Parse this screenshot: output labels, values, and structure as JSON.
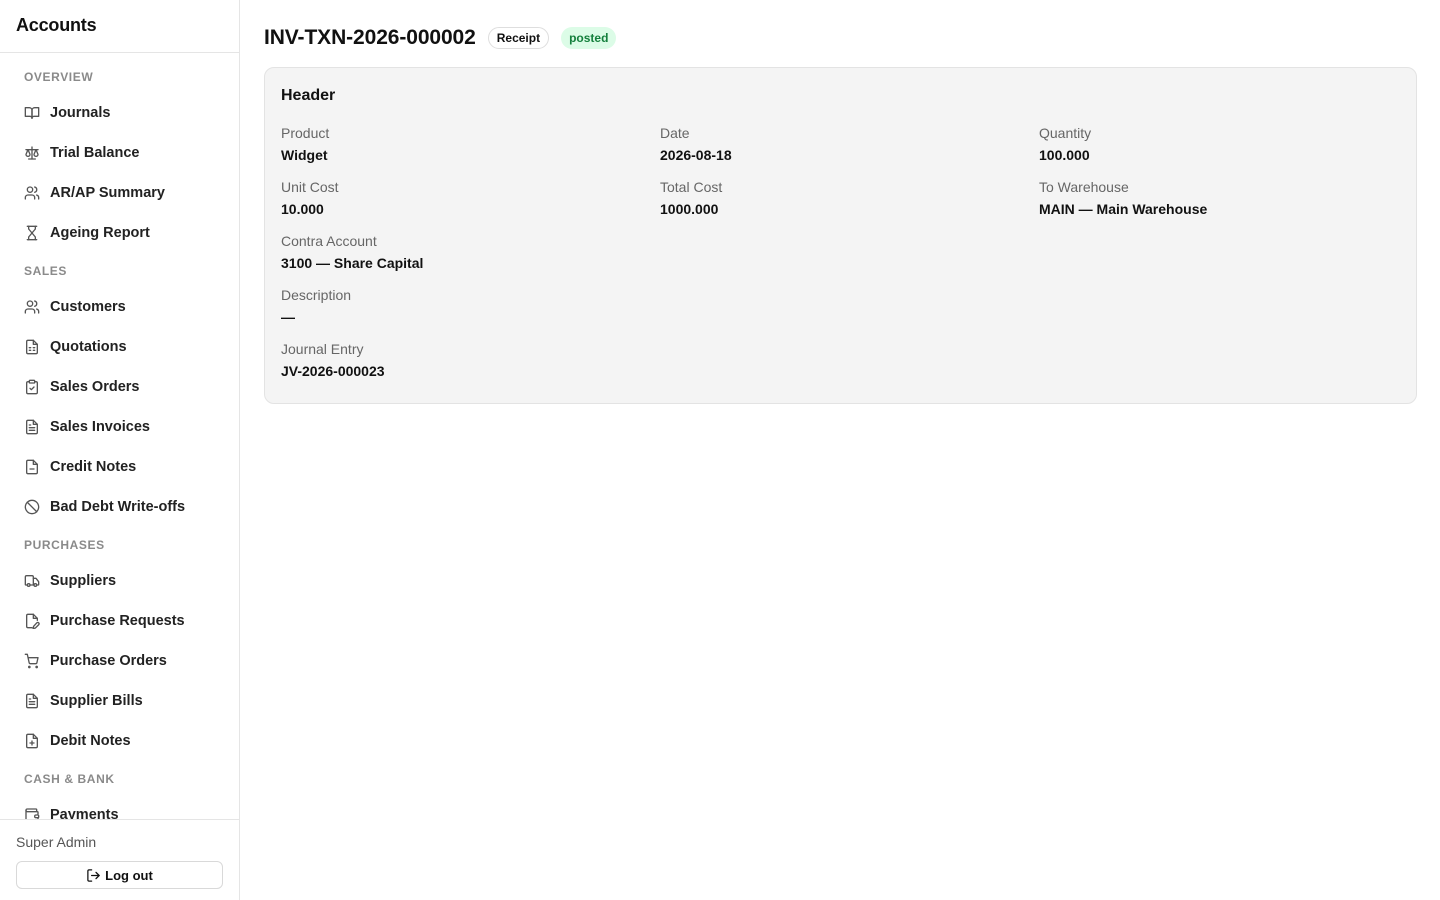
{
  "app": {
    "title": "Accounts"
  },
  "sidebar": {
    "sections": [
      {
        "label": "OVERVIEW",
        "items": [
          {
            "label": "Journals",
            "icon": "book-open-icon"
          },
          {
            "label": "Trial Balance",
            "icon": "scale-icon"
          },
          {
            "label": "AR/AP Summary",
            "icon": "users-icon"
          },
          {
            "label": "Ageing Report",
            "icon": "hourglass-icon"
          }
        ]
      },
      {
        "label": "SALES",
        "items": [
          {
            "label": "Customers",
            "icon": "users-icon"
          },
          {
            "label": "Quotations",
            "icon": "file-spreadsheet-icon"
          },
          {
            "label": "Sales Orders",
            "icon": "clipboard-check-icon"
          },
          {
            "label": "Sales Invoices",
            "icon": "file-text-icon"
          },
          {
            "label": "Credit Notes",
            "icon": "file-minus-icon"
          },
          {
            "label": "Bad Debt Write-offs",
            "icon": "ban-icon"
          }
        ]
      },
      {
        "label": "PURCHASES",
        "items": [
          {
            "label": "Suppliers",
            "icon": "truck-icon"
          },
          {
            "label": "Purchase Requests",
            "icon": "file-pen-icon"
          },
          {
            "label": "Purchase Orders",
            "icon": "shopping-cart-icon"
          },
          {
            "label": "Supplier Bills",
            "icon": "file-text-icon"
          },
          {
            "label": "Debit Notes",
            "icon": "file-plus-icon"
          }
        ]
      },
      {
        "label": "CASH & BANK",
        "items": [
          {
            "label": "Payments",
            "icon": "wallet-icon"
          }
        ]
      }
    ],
    "footer": {
      "user_name": "Super Admin",
      "logout_label": "Log out",
      "logout_icon": "log-out-icon"
    }
  },
  "page": {
    "title": "INV-TXN-2026-000002",
    "type_badge": "Receipt",
    "status_badge": "posted",
    "status_color": "#15803d",
    "status_bg": "#dcfce7"
  },
  "card": {
    "title": "Header",
    "fields": {
      "product": {
        "label": "Product",
        "value": "Widget"
      },
      "date": {
        "label": "Date",
        "value": "2026-08-18"
      },
      "quantity": {
        "label": "Quantity",
        "value": "100.000"
      },
      "unit_cost": {
        "label": "Unit Cost",
        "value": "10.000"
      },
      "total_cost": {
        "label": "Total Cost",
        "value": "1000.000"
      },
      "to_warehouse": {
        "label": "To Warehouse",
        "value": "MAIN — Main Warehouse"
      },
      "contra_account": {
        "label": "Contra Account",
        "value": "3100 — Share Capital"
      },
      "description": {
        "label": "Description",
        "value": "—"
      },
      "journal_entry": {
        "label": "Journal Entry",
        "value": "JV-2026-000023"
      }
    }
  }
}
